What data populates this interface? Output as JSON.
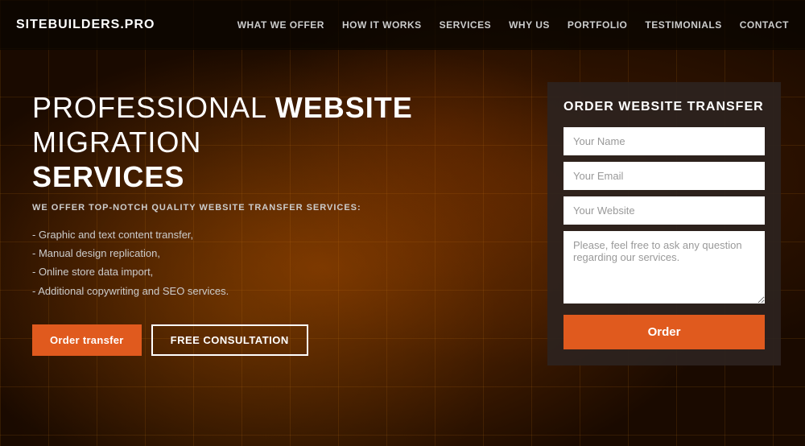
{
  "brand": {
    "logo": "SITEBUILDERS.PRO"
  },
  "nav": {
    "items": [
      {
        "label": "WHAT WE OFFER",
        "id": "what-we-offer"
      },
      {
        "label": "HOW IT WORKS",
        "id": "how-it-works"
      },
      {
        "label": "SERVICES",
        "id": "services"
      },
      {
        "label": "WHY US",
        "id": "why-us"
      },
      {
        "label": "PORTFOLIO",
        "id": "portfolio"
      },
      {
        "label": "TESTIMONIALS",
        "id": "testimonials"
      },
      {
        "label": "CONTACT",
        "id": "contact"
      }
    ]
  },
  "hero": {
    "title_prefix": "PROFESSIONAL ",
    "title_bold": "WEBSITE",
    "title_suffix": " MIGRATION",
    "title_line2": "SERVICES",
    "subtitle": "WE OFFER TOP-NOTCH QUALITY WEBSITE TRANSFER SERVICES:",
    "list_items": [
      "- Graphic and text content transfer,",
      "- Manual design replication,",
      "- Online store data import,",
      "- Additional copywriting and SEO services."
    ],
    "btn_order": "Order transfer",
    "btn_consultation": "FREE CONSULTATION"
  },
  "order_form": {
    "title": "ORDER WEBSITE TRANSFER",
    "name_placeholder": "Your Name",
    "email_placeholder": "Your Email",
    "website_placeholder": "Your Website",
    "message_placeholder": "Please, feel free to ask any question regarding our services.",
    "submit_label": "Order"
  }
}
